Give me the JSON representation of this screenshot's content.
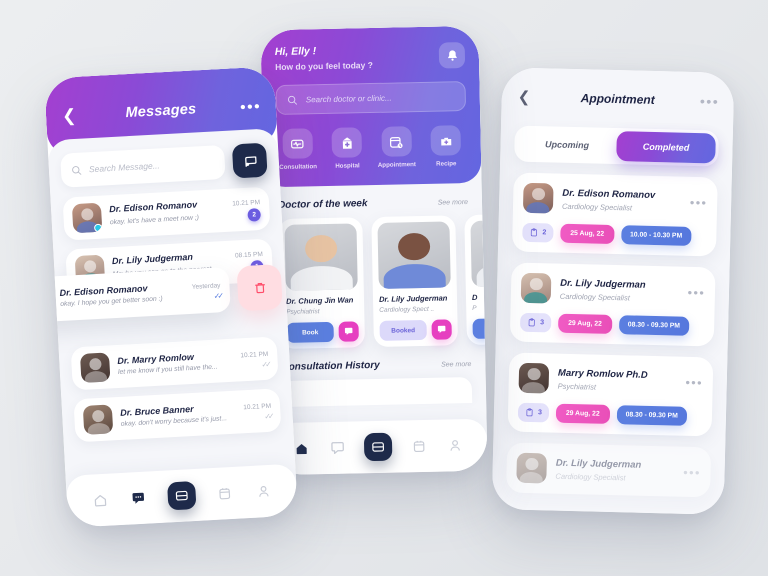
{
  "theme": {
    "gradient_start": "#a43fd0",
    "gradient_end": "#6366e0",
    "accent_blue": "#5b7fe0",
    "accent_pink": "#e94fb8",
    "accent_magenta": "#e63fc0",
    "badge_purple": "#6b5ce0",
    "dark_navy": "#1e2a4a",
    "page_background": "#e9ebee"
  },
  "messages_screen": {
    "header": {
      "back_icon": "chevron-left-icon",
      "title": "Messages",
      "more_icon": "more-dots-icon"
    },
    "search": {
      "placeholder": "Search Message...",
      "icon": "search-icon",
      "new_message_icon": "new-message-icon"
    },
    "conversations": [
      {
        "name": "Dr. Edison Romanov",
        "time": "10.21 PM",
        "preview": "okay. let's have a meet now ;)",
        "badge": "2",
        "online": true,
        "read": false
      },
      {
        "name": "Dr. Lily Judgerman",
        "time": "08.15 PM",
        "preview": "Maybe you can go to the nearest...",
        "badge": "1",
        "online": true,
        "read": false
      },
      {
        "name": "Dr. Marry Romlow",
        "time": "10.21 PM",
        "preview": "let me know if you still have the...",
        "badge": "",
        "online": false,
        "read": true
      },
      {
        "name": "Dr. Bruce Banner",
        "time": "10.21 PM",
        "preview": "okay. don't worry because it's just...",
        "badge": "",
        "online": false,
        "read": true
      }
    ],
    "swiped_conversation": {
      "name": "Dr. Edison Romanov",
      "time": "Yesterday",
      "preview": "okay. I hope you get better soon :)",
      "delete_icon": "trash-icon"
    },
    "bottom_nav": [
      {
        "icon": "home-icon",
        "active": false
      },
      {
        "icon": "chat-icon",
        "active": true
      },
      {
        "icon": "card-icon",
        "active": false,
        "center": true
      },
      {
        "icon": "calendar-icon",
        "active": false
      },
      {
        "icon": "profile-icon",
        "active": false
      }
    ]
  },
  "home_screen": {
    "greeting": "Hi, Elly !",
    "greeting_sub": "How do you feel today ?",
    "bell_icon": "bell-icon",
    "search": {
      "placeholder": "Search doctor or clinic...",
      "icon": "search-icon"
    },
    "categories": [
      {
        "label": "Consultation",
        "icon": "pulse-monitor-icon"
      },
      {
        "label": "Hospital",
        "icon": "hospital-icon"
      },
      {
        "label": "Appointment",
        "icon": "calendar-clock-icon"
      },
      {
        "label": "Recipe",
        "icon": "medical-bag-icon"
      }
    ],
    "doctor_section": {
      "title": "Doctor of the week",
      "see_more": "See more"
    },
    "doctors": [
      {
        "name": "Dr. Chung Jin Wan",
        "specialty": "Psychiatrist",
        "action": "Book",
        "booked": false,
        "chat_icon": "chat-bubble-icon"
      },
      {
        "name": "Dr. Lily Judgerman",
        "specialty": "Cardiology Spect ..",
        "action": "Booked",
        "booked": true,
        "chat_icon": "chat-bubble-icon"
      },
      {
        "name": "D",
        "specialty": "P",
        "action": "",
        "booked": false,
        "chat_icon": "chat-bubble-icon"
      }
    ],
    "history_section": {
      "title": "Consultation History",
      "see_more": "See more"
    },
    "bottom_nav": [
      {
        "icon": "home-icon",
        "active": true
      },
      {
        "icon": "chat-icon",
        "active": false
      },
      {
        "icon": "card-icon",
        "active": false,
        "center": true
      },
      {
        "icon": "calendar-icon",
        "active": false
      },
      {
        "icon": "profile-icon",
        "active": false
      }
    ]
  },
  "appointment_screen": {
    "header": {
      "back_icon": "chevron-left-icon",
      "title": "Appointment",
      "more_icon": "more-dots-icon"
    },
    "tabs": [
      {
        "label": "Upcoming",
        "active": false
      },
      {
        "label": "Completed",
        "active": true
      }
    ],
    "appointments": [
      {
        "name": "Dr. Edison Romanov",
        "specialty": "Cardiology Specialist",
        "count": "2",
        "date": "25 Aug, 22",
        "time": "10.00 - 10.30 PM",
        "more_icon": "more-dots-icon",
        "count_icon": "clipboard-icon"
      },
      {
        "name": "Dr. Lily Judgerman",
        "specialty": "Cardiology Specialist",
        "count": "3",
        "date": "29 Aug, 22",
        "time": "08.30 - 09.30 PM",
        "more_icon": "more-dots-icon",
        "count_icon": "clipboard-icon"
      },
      {
        "name": "Marry Romlow Ph.D",
        "specialty": "Psychiatrist",
        "count": "3",
        "date": "29 Aug, 22",
        "time": "08.30 - 09.30 PM",
        "more_icon": "more-dots-icon",
        "count_icon": "clipboard-icon"
      },
      {
        "name": "Dr. Lily Judgerman",
        "specialty": "Cardiology Specialist",
        "count": "",
        "date": "",
        "time": "",
        "more_icon": "more-dots-icon",
        "count_icon": "clipboard-icon"
      }
    ]
  }
}
